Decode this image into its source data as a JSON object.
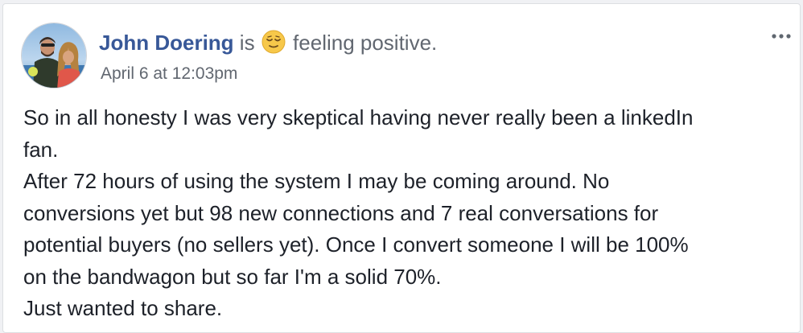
{
  "post": {
    "author": "John Doering",
    "activity_prefix": "is",
    "feeling_icon": "relieved-face-emoji",
    "feeling": "feeling positive.",
    "timestamp": "April 6 at 12:03pm",
    "more_icon": "more-options-icon",
    "body_lines": [
      "So in all honesty I was very skeptical having never really been a linkedIn",
      "fan.",
      "After 72 hours of using the system I may be coming around. No",
      "conversions yet but 98 new connections and 7 real conversations for",
      "potential buyers (no sellers yet). Once I convert someone I will be 100%",
      "on the bandwagon but so far I'm a solid 70%.",
      "Just wanted to share."
    ]
  },
  "colors": {
    "author": "#385898",
    "meta_text": "#616770",
    "body_text": "#1d2129",
    "card_bg": "#ffffff",
    "page_bg": "#f0f1f4"
  }
}
